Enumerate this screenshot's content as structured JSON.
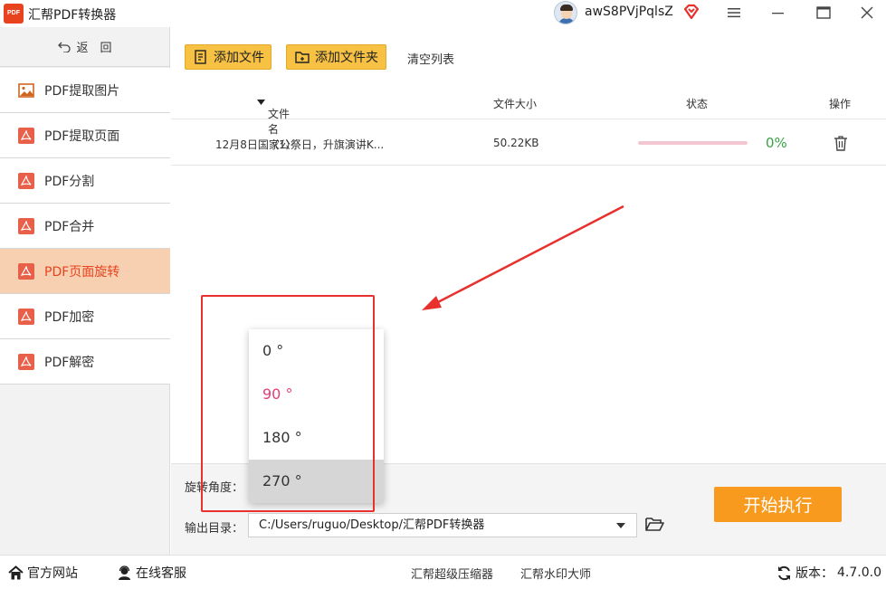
{
  "titlebar": {
    "logo_text": "PDF",
    "app_title": "汇帮PDF转换器",
    "username": "awS8PVjPqlsZ"
  },
  "sidebar": {
    "back_label": "返　回",
    "items": [
      {
        "label": "PDF提取图片",
        "icon": "image-icon"
      },
      {
        "label": "PDF提取页面",
        "icon": "pdf-icon"
      },
      {
        "label": "PDF分割",
        "icon": "pdf-icon"
      },
      {
        "label": "PDF合并",
        "icon": "pdf-icon"
      },
      {
        "label": "PDF页面旋转",
        "icon": "pdf-icon",
        "active": true
      },
      {
        "label": "PDF加密",
        "icon": "pdf-icon"
      },
      {
        "label": "PDF解密",
        "icon": "pdf-icon"
      }
    ]
  },
  "toolbar": {
    "add_file": "添加文件",
    "add_folder": "添加文件夹",
    "clear_list": "清空列表"
  },
  "table": {
    "headers": {
      "name": "文件名（1）",
      "size": "文件大小",
      "status": "状态",
      "action": "操作"
    },
    "rows": [
      {
        "name": "12月8日国家公祭日，升旗演讲K...",
        "size": "50.22KB",
        "progress": 0,
        "progress_label": "0%"
      }
    ]
  },
  "settings": {
    "rotation_label": "旋转角度：",
    "output_label": "输出目录：",
    "output_path": "C:/Users/ruguo/Desktop/汇帮PDF转换器",
    "rotation_options": [
      "0 °",
      "90 °",
      "180 °",
      "270 °"
    ],
    "rotation_selected": "90 °",
    "rotation_hovered": "270 °"
  },
  "actions": {
    "start": "开始执行"
  },
  "statusbar": {
    "website": "官方网站",
    "support": "在线客服",
    "compressor": "汇帮超级压缩器",
    "watermark": "汇帮水印大师",
    "version_label": "版本：",
    "version": "4.7.0.0"
  },
  "colors": {
    "accent_orange": "#f79a1e",
    "active_sidebar": "#f7d0b2",
    "button_yellow": "#f7c143",
    "annotation_red": "#e8302d",
    "progress_pink": "#e24b7a",
    "percent_green": "#3aa146"
  }
}
